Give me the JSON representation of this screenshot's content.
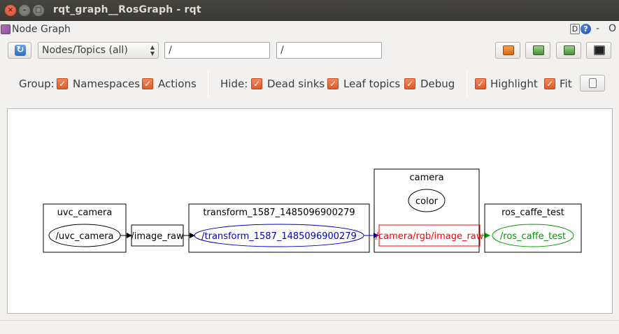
{
  "window": {
    "title": "rqt_graph__RosGraph - rqt",
    "close_glyph": "×",
    "min_glyph": "–",
    "max_glyph": "□"
  },
  "dock": {
    "title": "Node Graph",
    "btn_d": "D",
    "btn_help": "?",
    "btn_dash": "-",
    "btn_o": "O"
  },
  "toolbar": {
    "refresh_glyph": "↻",
    "view_mode": "Nodes/Topics (all)",
    "filter_include": "/",
    "filter_exclude": "/"
  },
  "options": {
    "group_label": "Group:",
    "namespaces": "Namespaces",
    "actions": "Actions",
    "hide_label": "Hide:",
    "dead_sinks": "Dead sinks",
    "leaf_topics": "Leaf topics",
    "debug": "Debug",
    "highlight": "Highlight",
    "fit": "Fit",
    "check_glyph": "✓"
  },
  "graph": {
    "namespaces": {
      "uvc_camera": "uvc_camera",
      "transform": "transform_1587_1485096900279",
      "camera": "camera",
      "ros_caffe_test": "ros_caffe_test"
    },
    "nodes": {
      "uvc_camera": "/uvc_camera",
      "transform": "/transform_1587_1485096900279",
      "color": "color",
      "ros_caffe_test": "/ros_caffe_test"
    },
    "topics": {
      "image_raw": "/image_raw",
      "camera_rgb_image_raw": "/camera/rgb/image_raw"
    },
    "colors": {
      "default": "#000000",
      "transform": "#0000cc",
      "camera_topic": "#ff0000",
      "ros_caffe_test": "#009900"
    }
  }
}
